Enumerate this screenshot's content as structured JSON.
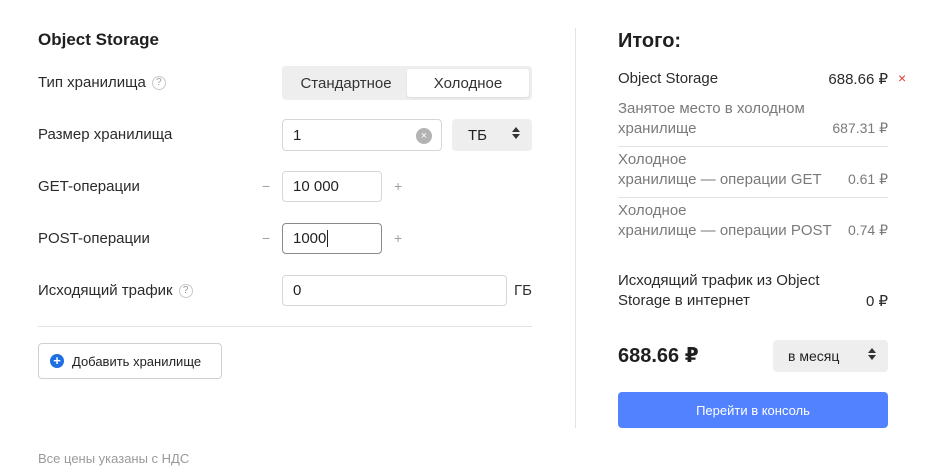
{
  "left": {
    "title": "Object Storage",
    "storage_type": {
      "label": "Тип хранилища",
      "help": "?",
      "options": [
        "Стандартное",
        "Холодное"
      ],
      "selected": "Холодное"
    },
    "storage_size": {
      "label": "Размер хранилища",
      "value": "1",
      "clear": "×",
      "unit": "ТБ"
    },
    "get_ops": {
      "label": "GET-операции",
      "minus": "−",
      "value": "10 000",
      "plus": "+"
    },
    "post_ops": {
      "label": "POST-операции",
      "minus": "−",
      "value": "1000",
      "plus": "+"
    },
    "traffic": {
      "label": "Исходящий трафик",
      "help": "?",
      "value": "0",
      "unit": "ГБ"
    },
    "add_storage": {
      "icon": "+",
      "label": "Добавить хранилище"
    },
    "footnote": "Все цены указаны с НДС"
  },
  "right": {
    "title": "Итого:",
    "main_item": {
      "label": "Object Storage",
      "price": "688.66 ₽",
      "remove": "×"
    },
    "subitems": [
      {
        "line1": "Занятое место в холодном",
        "line2": "хранилище",
        "price": "687.31 ₽"
      },
      {
        "line1": "Холодное",
        "line2": "хранилище — операции GET",
        "price": "0.61 ₽"
      },
      {
        "line1": "Холодное",
        "line2": "хранилище — операции POST",
        "price": "0.74 ₽"
      }
    ],
    "traffic": {
      "line1": "Исходящий трафик из Object",
      "line2": "Storage в интернет",
      "price": "0 ₽"
    },
    "total": "688.66 ₽",
    "period": "в месяц",
    "cta": "Перейти в консоль"
  },
  "colors": {
    "accent": "#5282ff",
    "add_icon": "#1e6fe0",
    "remove": "#e53935"
  },
  "icons": {
    "help": "help-icon",
    "clear": "clear-icon",
    "add": "plus-circle-icon",
    "remove": "close-icon",
    "select": "sort-arrows-icon"
  }
}
